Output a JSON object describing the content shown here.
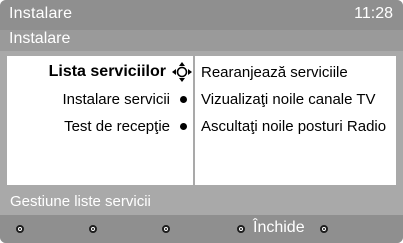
{
  "header": {
    "title": "Instalare",
    "time": "11:28"
  },
  "subheader": {
    "title": "Instalare"
  },
  "menu": {
    "items": [
      {
        "label": "Lista serviciilor",
        "selected": true
      },
      {
        "label": "Instalare servicii",
        "selected": false
      },
      {
        "label": "Test de recepţie",
        "selected": false
      }
    ]
  },
  "submenu": {
    "items": [
      {
        "label": "Rearanjează serviciile"
      },
      {
        "label": "Vizualizaţi noile canale TV"
      },
      {
        "label": "Ascultaţi noile posturi Radio"
      }
    ]
  },
  "status": {
    "text": "Gestiune liste servicii"
  },
  "footer": {
    "close_label": "Închide"
  },
  "colors": {
    "screen_bg": "#a9a9a9",
    "bar_bg": "#8f8f8f",
    "panel_bg": "#ffffff",
    "text_light": "#ffffff",
    "text_dark": "#000000"
  },
  "icons": {
    "nav_cursor": "navigation-cross-icon",
    "item_bullet": "dot-bullet-icon",
    "footer_buttons": "color-key-dot-icon"
  }
}
